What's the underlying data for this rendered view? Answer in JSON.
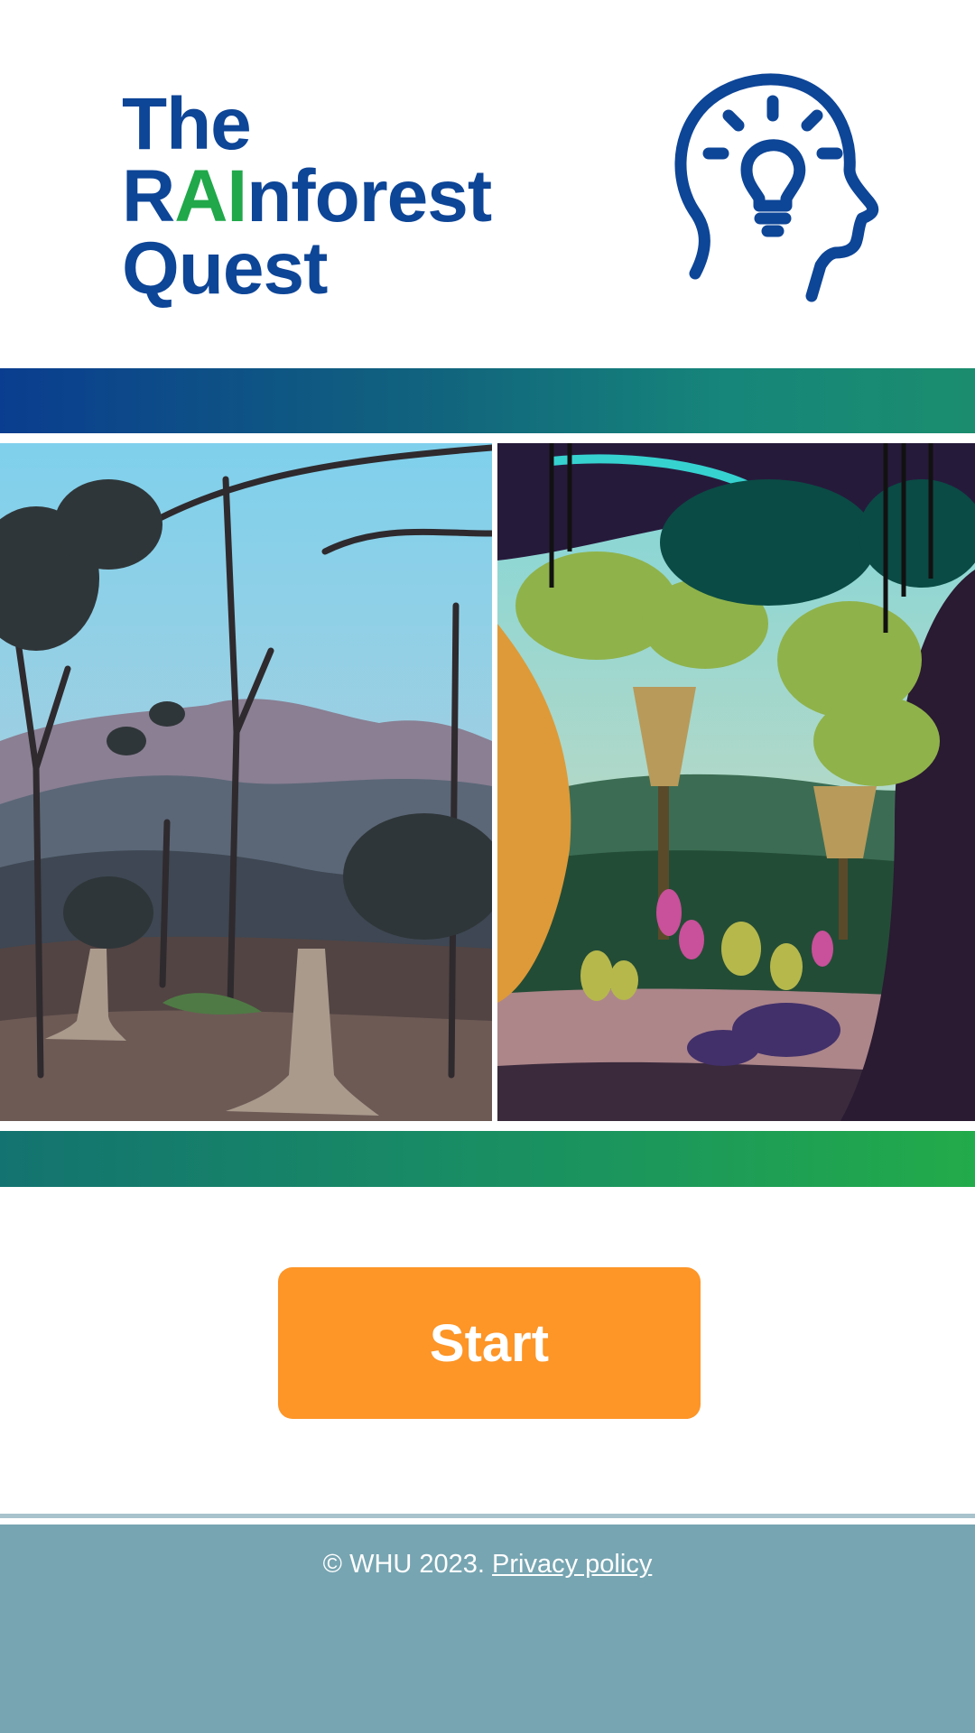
{
  "header": {
    "title_line1": "The",
    "title_line2_pre": "R",
    "title_line2_ai": "AI",
    "title_line2_post": "nforest",
    "title_line3": "Quest",
    "logo_icon": "head-lightbulb-icon",
    "title_color": "#0d4597",
    "ai_color": "#20a84a"
  },
  "images": {
    "left_icon": "deforested-landscape-illustration",
    "right_icon": "lush-rainforest-illustration"
  },
  "actions": {
    "start_label": "Start",
    "start_color": "#fd9527"
  },
  "footer": {
    "copyright": "© WHU 2023.",
    "privacy_label": "Privacy policy",
    "background": "#77a5b2"
  }
}
